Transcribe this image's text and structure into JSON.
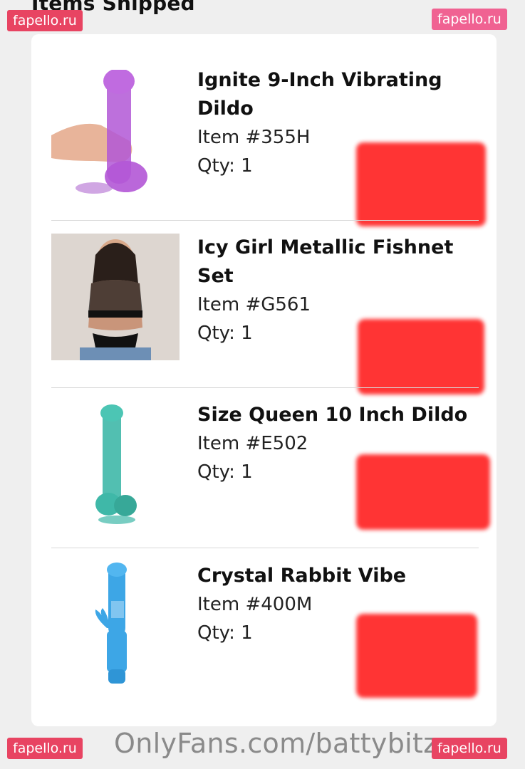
{
  "header": {
    "title": "Items Shipped"
  },
  "items": [
    {
      "name_line1": "Ignite 9-Inch Vibrating",
      "name_line2": "Dildo",
      "item_no": "Item #355H",
      "qty": "Qty: 1"
    },
    {
      "name_line1": "Icy Girl Metallic Fishnet",
      "name_line2": "Set",
      "item_no": "Item #G561",
      "qty": "Qty: 1"
    },
    {
      "name_line1": "Size Queen 10 Inch Dildo",
      "item_no": "Item #E502",
      "qty": "Qty: 1"
    },
    {
      "name_line1": "Crystal Rabbit Vibe",
      "item_no": "Item #400M",
      "qty": "Qty: 1"
    }
  ],
  "footer": {
    "text": "OnlyFans.com/battybitz"
  },
  "watermarks": {
    "top_left": "fapello.ru",
    "top_right": "fapello.ru",
    "bottom_left": "fapello.ru",
    "bottom_right": "fapello.ru"
  },
  "colors": {
    "redaction": "#ff2a2a",
    "watermark": "#e84462"
  }
}
